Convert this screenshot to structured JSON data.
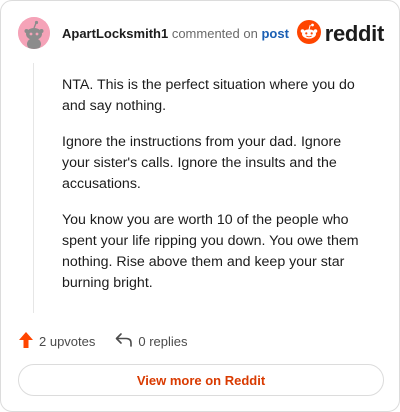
{
  "header": {
    "username": "ApartLocksmith1",
    "commented_on": "commented on",
    "post_link": "post",
    "brand_name": "reddit",
    "brand_icon": "reddit-snoo-icon",
    "avatar_icon": "snoo-avatar-icon"
  },
  "comment": {
    "paragraphs": [
      "NTA. This is the perfect situation where you do and say nothing.",
      "Ignore the instructions from your dad. Ignore your sister's calls. Ignore the insults and the accusations.",
      "You know you are worth 10 of the people who spent your life ripping you down. You owe them nothing. Rise above them and keep your star burning bright."
    ]
  },
  "actions": {
    "upvotes_label": "2 upvotes",
    "upvote_icon": "upvote-arrow-icon",
    "replies_label": "0 replies",
    "reply_icon": "reply-arrow-icon"
  },
  "footer": {
    "view_more_label": "View more on Reddit"
  },
  "colors": {
    "accent": "#d93a00",
    "upvote": "#ff4500",
    "link": "#1a5fb4",
    "avatar_bg": "#f5a3b8"
  }
}
